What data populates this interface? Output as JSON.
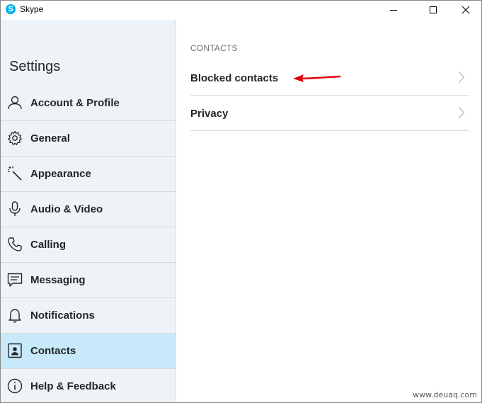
{
  "window": {
    "title": "Skype",
    "logo_letter": "S"
  },
  "sidebar": {
    "title": "Settings",
    "items": [
      {
        "label": "Account & Profile",
        "icon": "person-icon",
        "selected": false
      },
      {
        "label": "General",
        "icon": "gear-icon",
        "selected": false
      },
      {
        "label": "Appearance",
        "icon": "magic-wand-icon",
        "selected": false
      },
      {
        "label": "Audio & Video",
        "icon": "microphone-icon",
        "selected": false
      },
      {
        "label": "Calling",
        "icon": "phone-icon",
        "selected": false
      },
      {
        "label": "Messaging",
        "icon": "message-icon",
        "selected": false
      },
      {
        "label": "Notifications",
        "icon": "bell-icon",
        "selected": false
      },
      {
        "label": "Contacts",
        "icon": "contact-card-icon",
        "selected": true
      },
      {
        "label": "Help & Feedback",
        "icon": "info-icon",
        "selected": false
      }
    ]
  },
  "content": {
    "section_header": "CONTACTS",
    "rows": [
      {
        "label": "Blocked contacts",
        "icon": "chevron-right-icon"
      },
      {
        "label": "Privacy",
        "icon": "chevron-right-icon"
      }
    ]
  },
  "colors": {
    "sidebar_bg": "#eef3f8",
    "selected_bg": "#c7e9f9",
    "annotation_arrow": "#e3000f",
    "skype_blue": "#00aff0"
  },
  "watermark": "www.deuaq.com"
}
